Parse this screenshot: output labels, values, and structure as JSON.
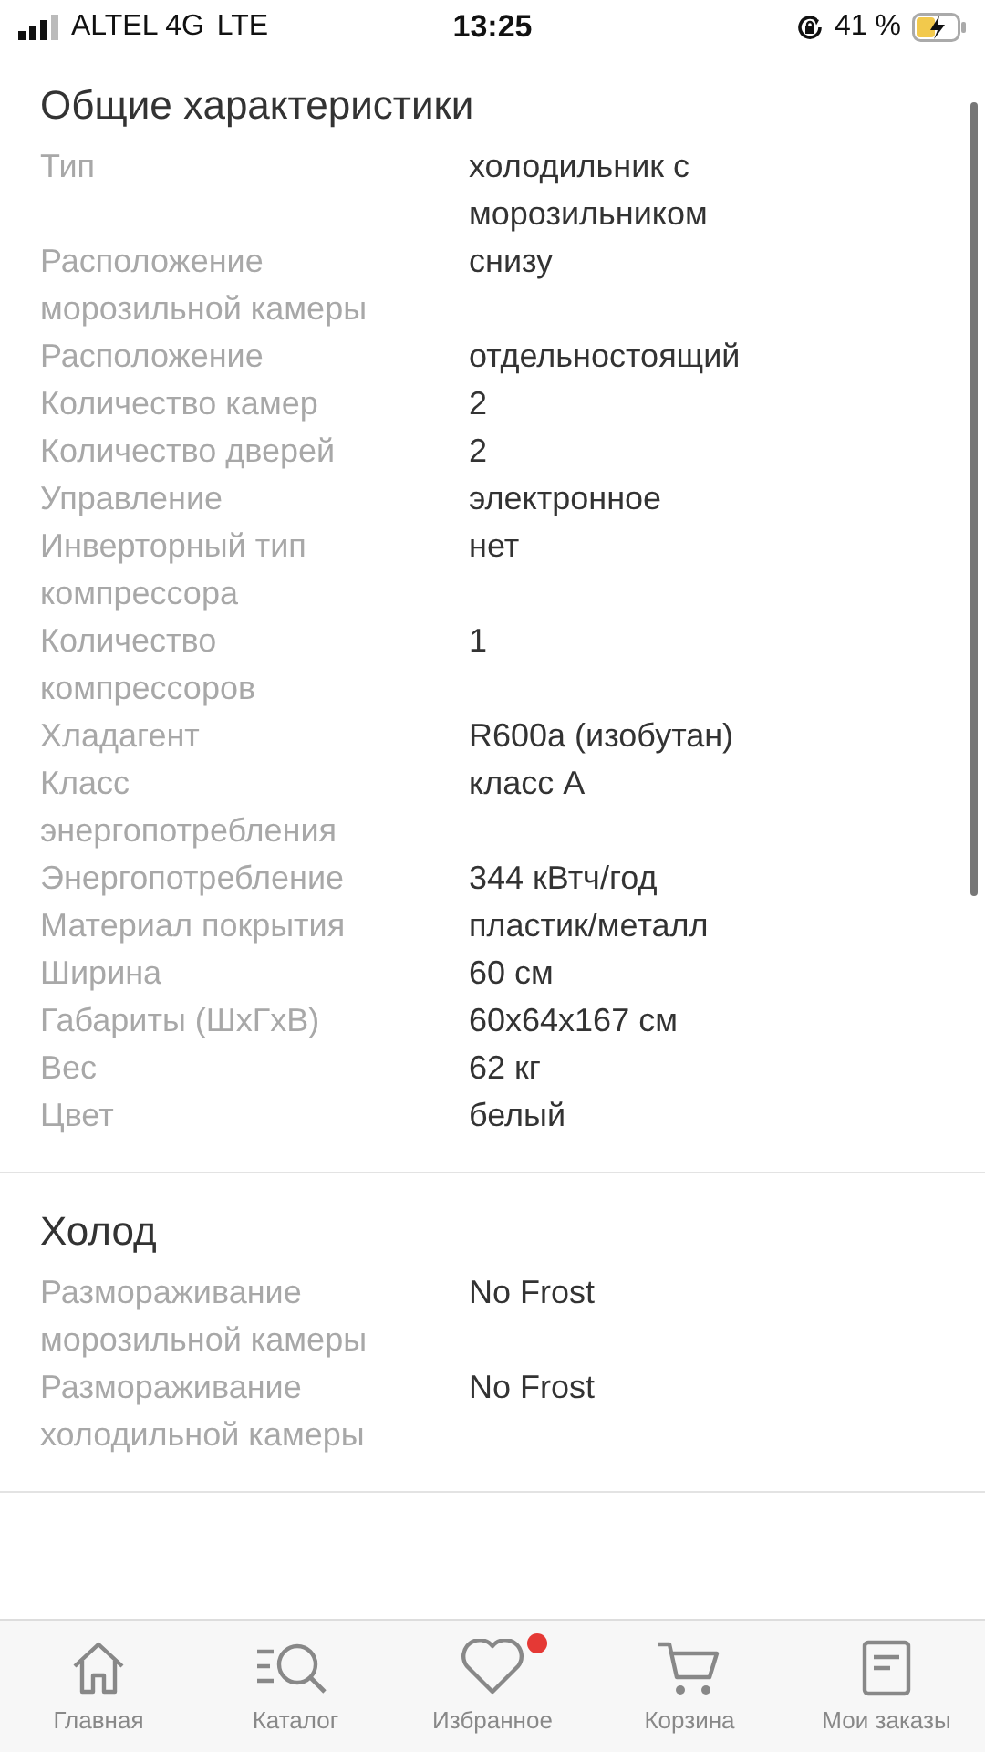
{
  "status_bar": {
    "carrier": "ALTEL 4G",
    "network": "LTE",
    "time": "13:25",
    "battery": "41 %"
  },
  "sections": [
    {
      "title": "Общие характеристики",
      "rows": [
        {
          "label": "Тип",
          "value": "холодильник с морозильником"
        },
        {
          "label": "Расположение морозильной камеры",
          "value": "снизу"
        },
        {
          "label": "Расположение",
          "value": "отдельностоящий"
        },
        {
          "label": "Количество камер",
          "value": "2"
        },
        {
          "label": "Количество дверей",
          "value": "2"
        },
        {
          "label": "Управление",
          "value": "электронное"
        },
        {
          "label": "Инверторный тип компрессора",
          "value": "нет"
        },
        {
          "label": "Количество компрессоров",
          "value": "1"
        },
        {
          "label": "Хладагент",
          "value": "R600a (изобутан)"
        },
        {
          "label": "Класс энергопотребления",
          "value": "класс A"
        },
        {
          "label": "Энергопотребление",
          "value": "344 кВтч/год"
        },
        {
          "label": "Материал покрытия",
          "value": "пластик/металл"
        },
        {
          "label": "Ширина",
          "value": "60 см"
        },
        {
          "label": "Габариты (ШхГхВ)",
          "value": "60x64x167 см"
        },
        {
          "label": "Вес",
          "value": "62 кг"
        },
        {
          "label": "Цвет",
          "value": "белый"
        }
      ]
    },
    {
      "title": "Холод",
      "rows": [
        {
          "label": "Размораживание морозильной камеры",
          "value": "No Frost"
        },
        {
          "label": "Размораживание холодильной камеры",
          "value": "No Frost"
        }
      ]
    }
  ],
  "tab_bar": [
    {
      "kind": "home",
      "label": "Главная",
      "badge": false
    },
    {
      "kind": "catalog",
      "label": "Каталог",
      "badge": false
    },
    {
      "kind": "favorites",
      "label": "Избранное",
      "badge": true
    },
    {
      "kind": "cart",
      "label": "Корзина",
      "badge": false
    },
    {
      "kind": "orders",
      "label": "Мои заказы",
      "badge": false
    }
  ]
}
